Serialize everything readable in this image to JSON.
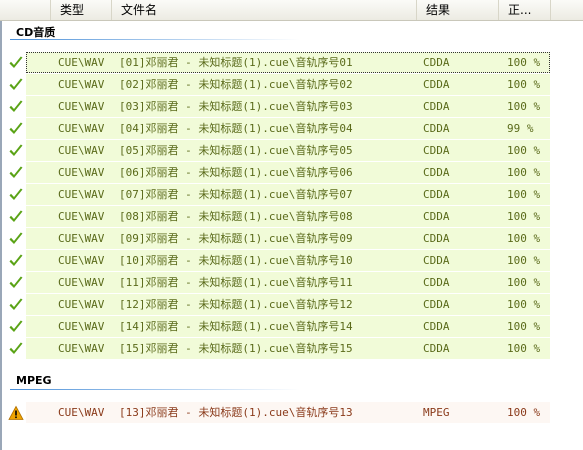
{
  "columns": [
    {
      "key": "blank",
      "label": ""
    },
    {
      "key": "type",
      "label": "类型"
    },
    {
      "key": "filename",
      "label": "文件名"
    },
    {
      "key": "result",
      "label": "结果"
    },
    {
      "key": "accuracy",
      "label": "正..."
    }
  ],
  "groups": [
    {
      "label": "CD音质",
      "rows": [
        {
          "status": "ok",
          "type": "CUE\\WAV",
          "filename": "[01]邓丽君  - 未知标题(1).cue\\音轨序号01",
          "result": "CDDA",
          "accuracy": "100 %",
          "selected": true
        },
        {
          "status": "ok",
          "type": "CUE\\WAV",
          "filename": "[02]邓丽君  - 未知标题(1).cue\\音轨序号02",
          "result": "CDDA",
          "accuracy": "100 %"
        },
        {
          "status": "ok",
          "type": "CUE\\WAV",
          "filename": "[03]邓丽君  - 未知标题(1).cue\\音轨序号03",
          "result": "CDDA",
          "accuracy": "100 %"
        },
        {
          "status": "ok",
          "type": "CUE\\WAV",
          "filename": "[04]邓丽君  - 未知标题(1).cue\\音轨序号04",
          "result": "CDDA",
          "accuracy": "99 %"
        },
        {
          "status": "ok",
          "type": "CUE\\WAV",
          "filename": "[05]邓丽君  - 未知标题(1).cue\\音轨序号05",
          "result": "CDDA",
          "accuracy": "100 %"
        },
        {
          "status": "ok",
          "type": "CUE\\WAV",
          "filename": "[06]邓丽君  - 未知标题(1).cue\\音轨序号06",
          "result": "CDDA",
          "accuracy": "100 %"
        },
        {
          "status": "ok",
          "type": "CUE\\WAV",
          "filename": "[07]邓丽君  - 未知标题(1).cue\\音轨序号07",
          "result": "CDDA",
          "accuracy": "100 %"
        },
        {
          "status": "ok",
          "type": "CUE\\WAV",
          "filename": "[08]邓丽君  - 未知标题(1).cue\\音轨序号08",
          "result": "CDDA",
          "accuracy": "100 %"
        },
        {
          "status": "ok",
          "type": "CUE\\WAV",
          "filename": "[09]邓丽君  - 未知标题(1).cue\\音轨序号09",
          "result": "CDDA",
          "accuracy": "100 %"
        },
        {
          "status": "ok",
          "type": "CUE\\WAV",
          "filename": "[10]邓丽君  - 未知标题(1).cue\\音轨序号10",
          "result": "CDDA",
          "accuracy": "100 %"
        },
        {
          "status": "ok",
          "type": "CUE\\WAV",
          "filename": "[11]邓丽君  - 未知标题(1).cue\\音轨序号11",
          "result": "CDDA",
          "accuracy": "100 %"
        },
        {
          "status": "ok",
          "type": "CUE\\WAV",
          "filename": "[12]邓丽君  - 未知标题(1).cue\\音轨序号12",
          "result": "CDDA",
          "accuracy": "100 %"
        },
        {
          "status": "ok",
          "type": "CUE\\WAV",
          "filename": "[14]邓丽君  - 未知标题(1).cue\\音轨序号14",
          "result": "CDDA",
          "accuracy": "100 %"
        },
        {
          "status": "ok",
          "type": "CUE\\WAV",
          "filename": "[15]邓丽君  - 未知标题(1).cue\\音轨序号15",
          "result": "CDDA",
          "accuracy": "100 %"
        }
      ]
    },
    {
      "label": "MPEG",
      "rows": [
        {
          "status": "warn",
          "type": "CUE\\WAV",
          "filename": "[13]邓丽君  - 未知标题(1).cue\\音轨序号13",
          "result": "MPEG",
          "accuracy": "100 %"
        }
      ]
    }
  ],
  "colors": {
    "ok": "#5aa316",
    "warn": "#f0a400",
    "row_bg": "#f1fbd8",
    "text": "#5a6a1a"
  },
  "icons": {
    "ok": "checkmark-icon",
    "warn": "warning-triangle-icon"
  }
}
